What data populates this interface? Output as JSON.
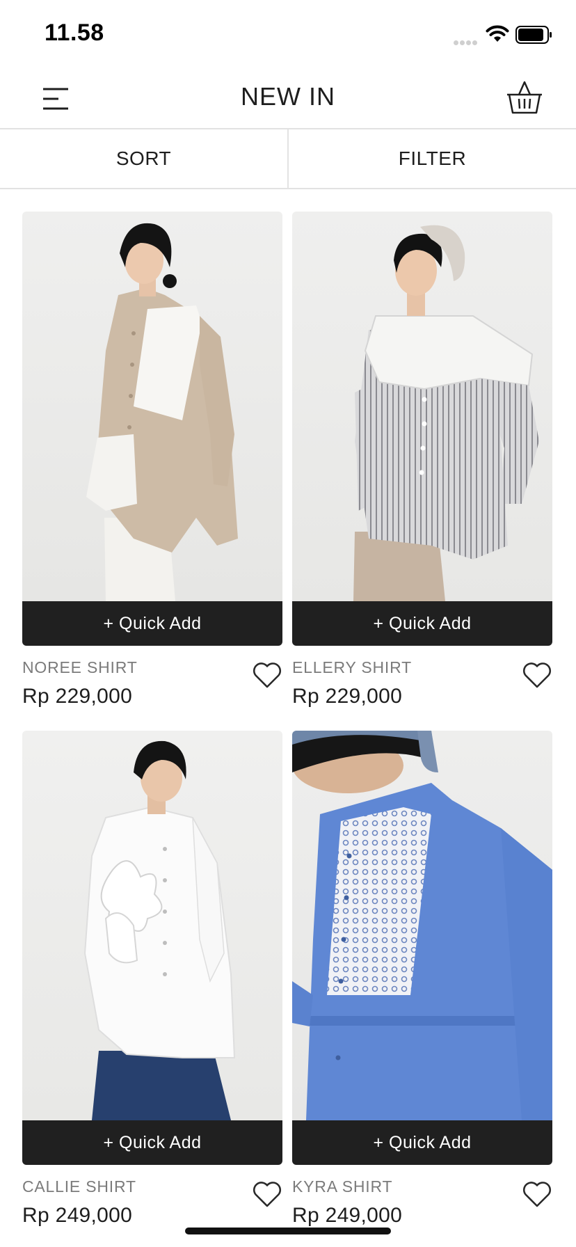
{
  "status_bar": {
    "time": "11.58"
  },
  "header": {
    "title": "NEW IN",
    "menu_icon": "hamburger-menu-icon",
    "cart_icon": "basket-icon"
  },
  "toolbar": {
    "sort_label": "SORT",
    "filter_label": "FILTER"
  },
  "products": [
    {
      "name": "NOREE SHIRT",
      "price": "Rp 229,000",
      "quick_add": "+ Quick Add"
    },
    {
      "name": "ELLERY SHIRT",
      "price": "Rp 229,000",
      "quick_add": "+ Quick Add"
    },
    {
      "name": "CALLIE SHIRT",
      "price": "Rp 249,000",
      "quick_add": "+ Quick Add"
    },
    {
      "name": "KYRA SHIRT",
      "price": "Rp 249,000",
      "quick_add": "+ Quick Add"
    }
  ],
  "colors": {
    "quick_add_bg": "#202020",
    "divider": "#e2e2e2",
    "name_text": "#7b7b7b"
  }
}
